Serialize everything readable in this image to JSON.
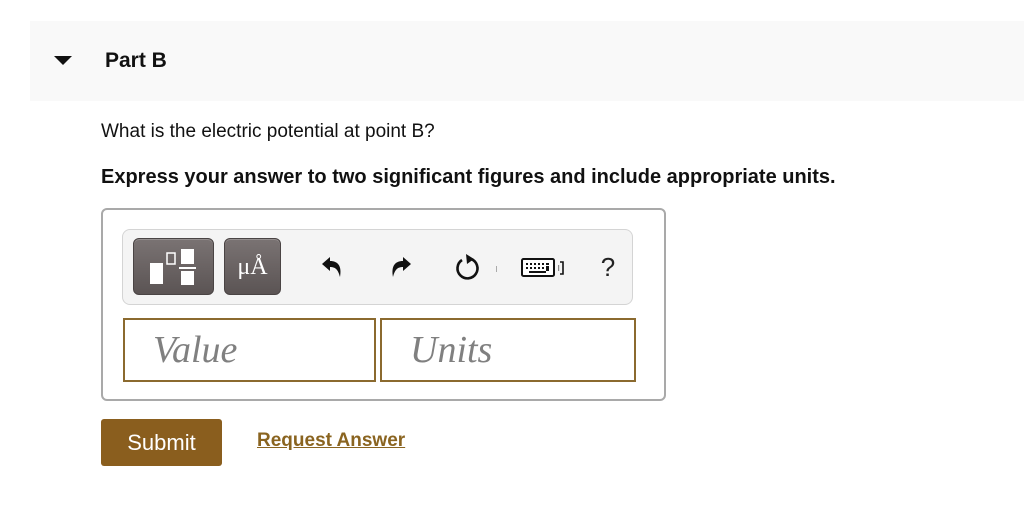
{
  "part": {
    "title": "Part B",
    "expanded": true
  },
  "question": {
    "text": "What is the electric potential at point B?",
    "instruction": "Express your answer to two significant figures and include appropriate units."
  },
  "toolbar": {
    "buttons": [
      {
        "name": "templates",
        "icon": "templates-icon"
      },
      {
        "name": "units",
        "label": "μÅ",
        "icon": "units-icon"
      },
      {
        "name": "undo",
        "icon": "undo-icon"
      },
      {
        "name": "redo",
        "icon": "redo-icon"
      },
      {
        "name": "reset",
        "icon": "reset-icon"
      },
      {
        "name": "keyboard",
        "icon": "keyboard-icon"
      },
      {
        "name": "help",
        "label": "?",
        "icon": "help-icon"
      }
    ],
    "units_label": "μÅ",
    "help_label": "?"
  },
  "inputs": {
    "value": {
      "placeholder": "Value",
      "current": ""
    },
    "units": {
      "placeholder": "Units",
      "current": ""
    }
  },
  "actions": {
    "submit_label": "Submit",
    "request_answer_label": "Request Answer"
  },
  "colors": {
    "accent": "#8a5e1e",
    "link": "#8a6420",
    "input_border": "#8b6a2f",
    "header_bg": "#f9f9f9"
  }
}
